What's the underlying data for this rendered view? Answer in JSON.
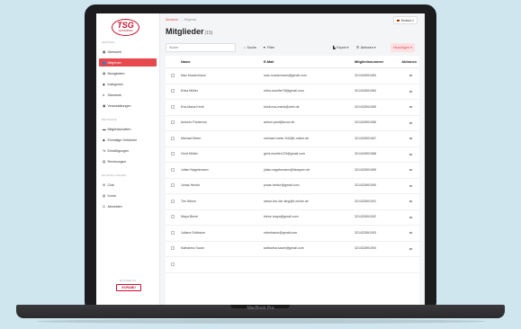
{
  "device": {
    "brand": "MacBook Pro"
  },
  "sidebar": {
    "logo": {
      "text": "TSG",
      "sub": "FECHENHEIM"
    },
    "sections": [
      {
        "title": "ZENTRAL",
        "items": [
          {
            "label": "Übersicht",
            "icon": "grid-icon"
          },
          {
            "label": "Mitglieder",
            "icon": "users-icon",
            "active": true
          },
          {
            "label": "Neuigkeiten",
            "icon": "news-icon"
          },
          {
            "label": "Kategorien",
            "icon": "tag-icon"
          },
          {
            "label": "Standorte",
            "icon": "location-icon"
          },
          {
            "label": "Veranstaltungen",
            "icon": "calendar-icon"
          }
        ]
      },
      {
        "title": "BEITRÄGE",
        "items": [
          {
            "label": "Mitgliedschaften",
            "icon": "card-icon"
          },
          {
            "label": "Einmalige Gebühren",
            "icon": "tag-icon"
          },
          {
            "label": "Ermäßigungen",
            "icon": "percent-icon"
          },
          {
            "label": "Rechnungen",
            "icon": "invoice-icon"
          }
        ]
      },
      {
        "title": "EINSTELLUNGEN",
        "items": [
          {
            "label": "Club",
            "icon": "gear-icon"
          },
          {
            "label": "Konto",
            "icon": "bank-icon"
          },
          {
            "label": "Abmelden",
            "icon": "logout-icon"
          }
        ]
      }
    ],
    "footer": {
      "label": "Ein Produkt von",
      "brand": "KURABU"
    }
  },
  "header": {
    "breadcrumb": {
      "parent": "Übersicht",
      "current": "Mitglieder"
    },
    "language": "Deutsch",
    "title": "Mitglieder",
    "count": "(15)"
  },
  "toolbar": {
    "search_placeholder": "Suche",
    "search_button": "Suche",
    "filter_button": "Filter",
    "export_button": "Export",
    "actions_button": "Aktionen",
    "add_button": "Hinzufügen"
  },
  "table": {
    "columns": [
      "Name",
      "E-Mail",
      "Mitgliedsnummer",
      "Aktionen"
    ],
    "rows": [
      {
        "name": "Max Mustermann",
        "email": "max.mustermann@gmail.com",
        "number": "321432891083"
      },
      {
        "name": "Erika Müller",
        "email": "erika-mueller78@gmail.com",
        "number": "321432891084"
      },
      {
        "name": "Eva-Maria Kindl",
        "email": "kindl.eva-maria@web.de",
        "number": "321432891085"
      },
      {
        "name": "Antonio Panterros",
        "email": "antoni.pant@arcor.de",
        "number": "321432891086"
      },
      {
        "name": "Michael Meier",
        "email": "michael-meier-943@t-online.de",
        "number": "321432891087"
      },
      {
        "name": "Gerd Müller",
        "email": "gerd.mueller123@gmail.com",
        "number": "321432891088"
      },
      {
        "name": "Julian Nagelsmann",
        "email": "julian.nagelsmann@fcbayern.de",
        "number": "321432891089"
      },
      {
        "name": "Jonas Hector",
        "email": "jonas.hector@gmail.com",
        "number": "321432891090"
      },
      {
        "name": "Tim Wiese",
        "email": "wiese-tim-der-king@t-online.de",
        "number": "321432891091"
      },
      {
        "name": "Maya Biene",
        "email": "biene.maya@gmail.com",
        "number": "321432891092"
      },
      {
        "name": "Juliane Rotbaum",
        "email": "rotenbaum@gmail.com",
        "number": "321432891093"
      },
      {
        "name": "Katharina Sauer",
        "email": "katharina.sauer@gmail.com",
        "number": "321432891094"
      },
      {
        "name": "",
        "email": "",
        "number": ""
      }
    ]
  },
  "colors": {
    "accent": "#e5484d",
    "brand": "#c8102e",
    "background": "#cfe6ee"
  }
}
